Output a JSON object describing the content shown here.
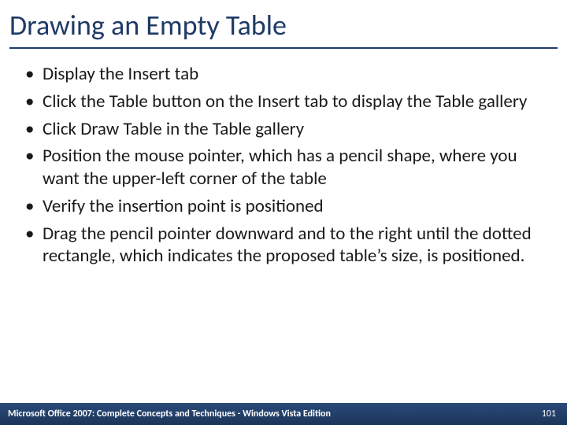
{
  "title": "Drawing an Empty Table",
  "bullets": [
    "Display the Insert tab",
    "Click the Table button on the Insert tab to display the Table gallery",
    "Click Draw Table in the Table gallery",
    "Position the mouse pointer, which has a pencil shape, where you want the upper-left corner of the table",
    "Verify the insertion point is positioned",
    "Drag the pencil pointer downward and to the right until the dotted rectangle, which indicates the proposed table’s size, is positioned."
  ],
  "footer": {
    "text": "Microsoft Office 2007: Complete Concepts and Techniques - Windows Vista Edition",
    "page": "101"
  }
}
